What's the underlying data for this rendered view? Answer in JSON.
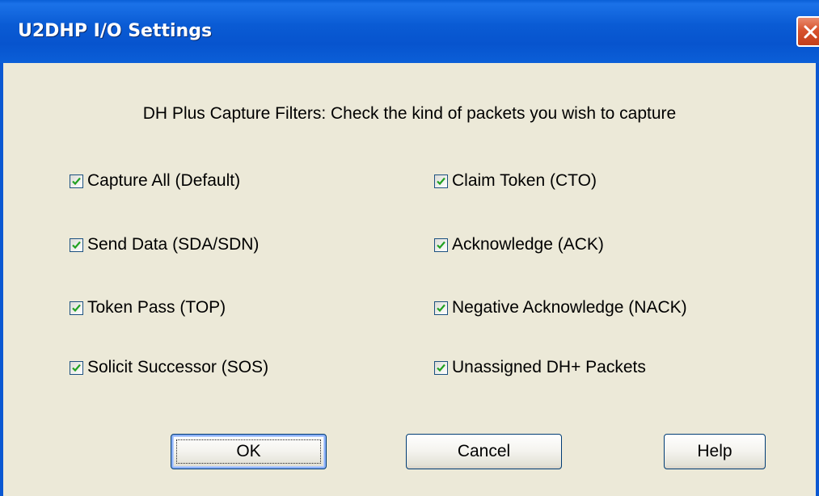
{
  "window": {
    "title": "U2DHP I/O Settings",
    "close_icon": "close-icon",
    "title_bar_color": "#0A5BD4",
    "close_color": "#D7532E"
  },
  "instruction": "DH Plus Capture Filters: Check the kind of packets you wish to capture",
  "filters": {
    "left": [
      {
        "label": "Capture All (Default)",
        "checked": true
      },
      {
        "label": "Send Data (SDA/SDN)",
        "checked": true
      },
      {
        "label": "Token Pass (TOP)",
        "checked": true
      },
      {
        "label": "Solicit Successor (SOS)",
        "checked": true
      }
    ],
    "right": [
      {
        "label": "Claim Token (CTO)",
        "checked": true
      },
      {
        "label": "Acknowledge (ACK)",
        "checked": true
      },
      {
        "label": "Negative Acknowledge (NACK)",
        "checked": true
      },
      {
        "label": "Unassigned DH+ Packets",
        "checked": true
      }
    ]
  },
  "buttons": {
    "ok": "OK",
    "cancel": "Cancel",
    "help": "Help"
  }
}
